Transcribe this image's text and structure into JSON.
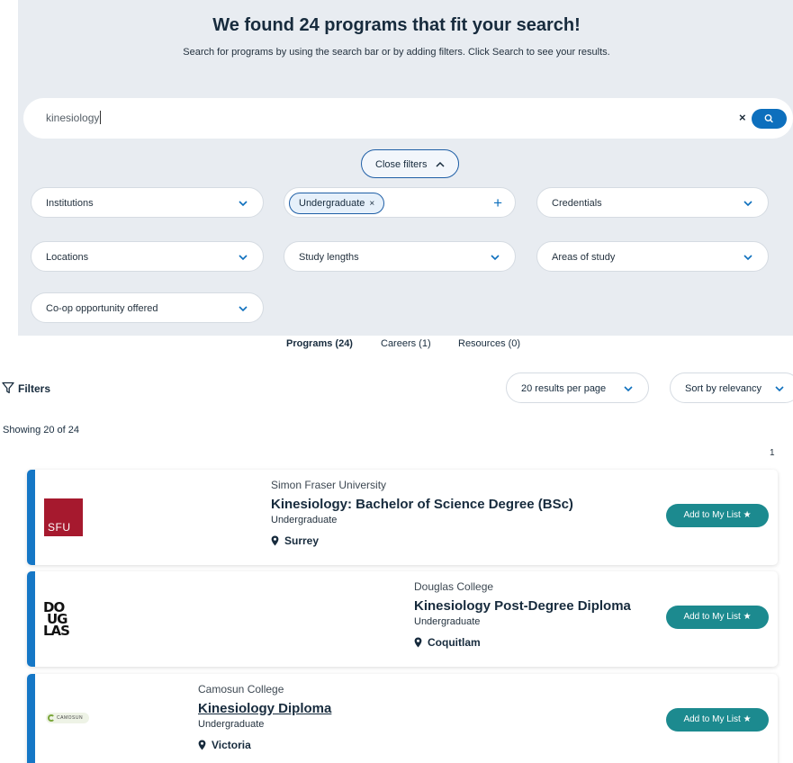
{
  "header": {
    "title": "We found 24 programs that fit your search!",
    "subtitle": "Search for programs by using the search bar or by adding filters. Click Search to see your results."
  },
  "search": {
    "value": "kinesiology",
    "clear_label": "×"
  },
  "filters_panel": {
    "close_label": "Close filters",
    "institutions": "Institutions",
    "study_level_chip": "Undergraduate",
    "chip_remove": "×",
    "add_label": "+",
    "credentials": "Credentials",
    "locations": "Locations",
    "study_lengths": "Study lengths",
    "areas_of_study": "Areas of study",
    "coop": "Co-op opportunity offered"
  },
  "tabs": [
    {
      "label": "Programs (24)",
      "active": true
    },
    {
      "label": "Careers (1)",
      "active": false
    },
    {
      "label": "Resources (0)",
      "active": false
    }
  ],
  "toolbar": {
    "filters_label": "Filters",
    "per_page": "20 results per page",
    "sort": "Sort by relevancy"
  },
  "results": {
    "showing": "Showing 20 of 24",
    "current_page": "1",
    "add_label": "Add to My List ★",
    "items": [
      {
        "institution": "Simon Fraser University",
        "program": "Kinesiology: Bachelor of Science Degree (BSc)",
        "credential": "Undergraduate",
        "location": "Surrey",
        "logo_text": "SFU"
      },
      {
        "institution": "Douglas College",
        "program": "Kinesiology Post-Degree Diploma",
        "credential": "Undergraduate",
        "location": "Coquitlam",
        "logo_text": "DOUGLAS"
      },
      {
        "institution": "Camosun College",
        "program": "Kinesiology Diploma",
        "credential": "Undergraduate",
        "location": "Victoria",
        "logo_text": "CAMOSUN"
      }
    ]
  },
  "colors": {
    "panel_bg": "#e8ecf1",
    "primary_blue": "#0d6fbd",
    "card_accent": "#1577c6",
    "add_button": "#1c8a8f",
    "sfu_red": "#a6192e"
  },
  "icons": [
    "search-icon",
    "chevron-down-icon",
    "chevron-up-icon",
    "filter-icon",
    "map-pin-icon",
    "star-icon",
    "plus-icon",
    "close-icon"
  ]
}
